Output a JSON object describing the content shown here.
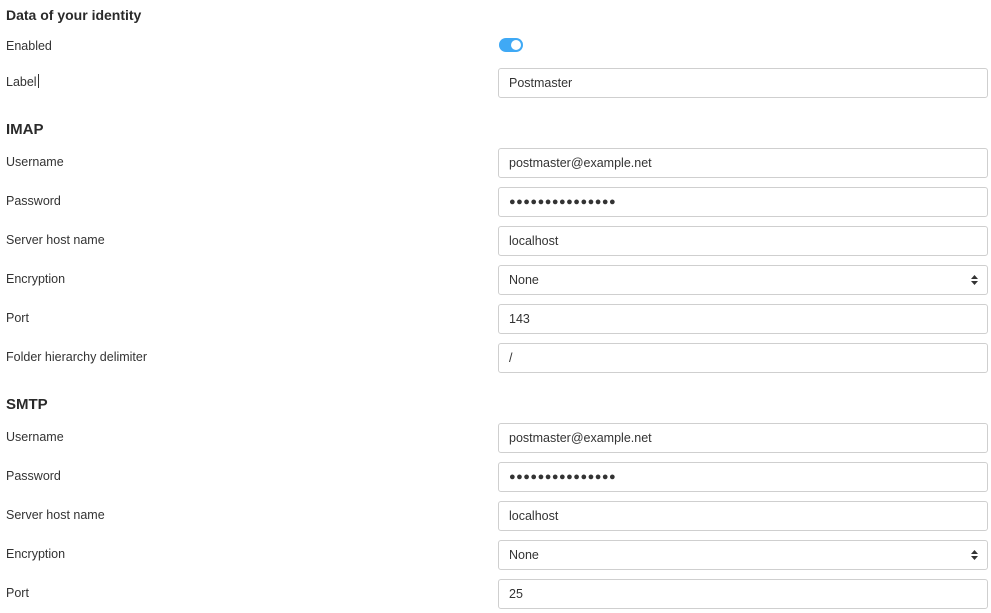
{
  "identity": {
    "heading": "Data of your identity",
    "enabled_label": "Enabled",
    "enabled_value": true,
    "label_label": "Label",
    "label_value": "Postmaster"
  },
  "imap": {
    "heading": "IMAP",
    "username_label": "Username",
    "username_value": "postmaster@example.net",
    "password_label": "Password",
    "password_value": "●●●●●●●●●●●●●●●",
    "host_label": "Server host name",
    "host_value": "localhost",
    "encryption_label": "Encryption",
    "encryption_value": "None",
    "port_label": "Port",
    "port_value": "143",
    "delimiter_label": "Folder hierarchy delimiter",
    "delimiter_value": "/"
  },
  "smtp": {
    "heading": "SMTP",
    "username_label": "Username",
    "username_value": "postmaster@example.net",
    "password_label": "Password",
    "password_value": "●●●●●●●●●●●●●●●",
    "host_label": "Server host name",
    "host_value": "localhost",
    "encryption_label": "Encryption",
    "encryption_value": "None",
    "port_label": "Port",
    "port_value": "25"
  },
  "colors": {
    "toggle_on": "#3fa9f5",
    "border": "#cfcfcf"
  }
}
